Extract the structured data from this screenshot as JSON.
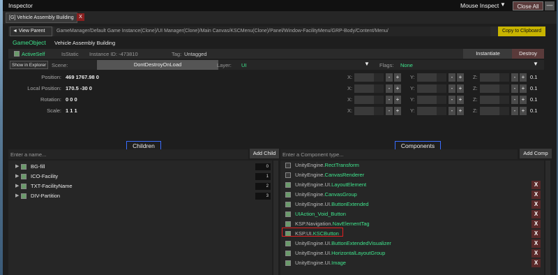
{
  "window": {
    "title": "Inspector",
    "mouse_inspect": "Mouse Inspect",
    "dropdown_arrow": "▼",
    "close_all": "Close All",
    "minimize": "—"
  },
  "tab": {
    "label": "[G] Vehicle Assembly Building",
    "close": "X"
  },
  "path": {
    "view_parent": "◄ View Parent",
    "text": "GameManager/Default Game Instance(Clone)/UI Manager(Clone)/Main Canvas/KSCMenu(Clone)/Panel/Window-FacilityMenu/GRP-Body/Content/Menu/",
    "copy": "Copy to Clipboard"
  },
  "gameobject": {
    "label": "GameObject",
    "name": "Vehicle Assembly Building"
  },
  "props": {
    "active_self": "ActiveSelf",
    "is_static": "IsStatic",
    "instance_id": "Instance ID: -473810",
    "tag_label": "Tag:",
    "tag_value": "Untagged",
    "instantiate": "Instantiate",
    "destroy": "Destroy"
  },
  "scene": {
    "show_explorer": "Show in Explorer",
    "scene_label": "Scene:",
    "scene_value": "DontDestroyOnLoad",
    "layer_label": "Layer:",
    "layer_value": "UI",
    "flags_label": "Flags:",
    "flags_value": "None"
  },
  "transform": [
    {
      "label": "Position:",
      "value": "469 1767.98 0"
    },
    {
      "label": "Local Position:",
      "value": "170.5 -30 0"
    },
    {
      "label": "Rotation:",
      "value": "0 0 0"
    },
    {
      "label": "Scale:",
      "value": "1 1 1"
    }
  ],
  "axes": {
    "x": "X:",
    "y": "Y:",
    "z": "Z:",
    "minus": "-",
    "plus": "+",
    "step": "0.1"
  },
  "children": {
    "header": "Children",
    "placeholder": "Enter a name...",
    "add": "Add Child",
    "items": [
      {
        "name": "BG-fill",
        "count": "0"
      },
      {
        "name": "ICO-Facility",
        "count": "1"
      },
      {
        "name": "TXT-FacilityName",
        "count": "2"
      },
      {
        "name": "DIV-Partition",
        "count": "3"
      }
    ]
  },
  "components": {
    "header": "Components",
    "placeholder": "Enter a Component type...",
    "add": "Add Comp",
    "remove": "X",
    "items": [
      {
        "ns": "UnityEngine.",
        "cls": "RectTransform"
      },
      {
        "ns": "UnityEngine.",
        "cls": "CanvasRenderer"
      },
      {
        "ns": "UnityEngine.UI.",
        "cls": "LayoutElement"
      },
      {
        "ns": "UnityEngine.",
        "cls": "CanvasGroup"
      },
      {
        "ns": "UnityEngine.UI.",
        "cls": "ButtonExtended"
      },
      {
        "ns": "",
        "cls": "UIAction_Void_Button"
      },
      {
        "ns": "KSP.Navigation.",
        "cls": "NavElementTag"
      },
      {
        "ns": "KSP.UI.",
        "cls": "KSCButton"
      },
      {
        "ns": "UnityEngine.UI.",
        "cls": "ButtonExtendedVisualizer"
      },
      {
        "ns": "UnityEngine.UI.",
        "cls": "HorizontalLayoutGroup"
      },
      {
        "ns": "UnityEngine.UI.",
        "cls": "Image"
      }
    ]
  }
}
